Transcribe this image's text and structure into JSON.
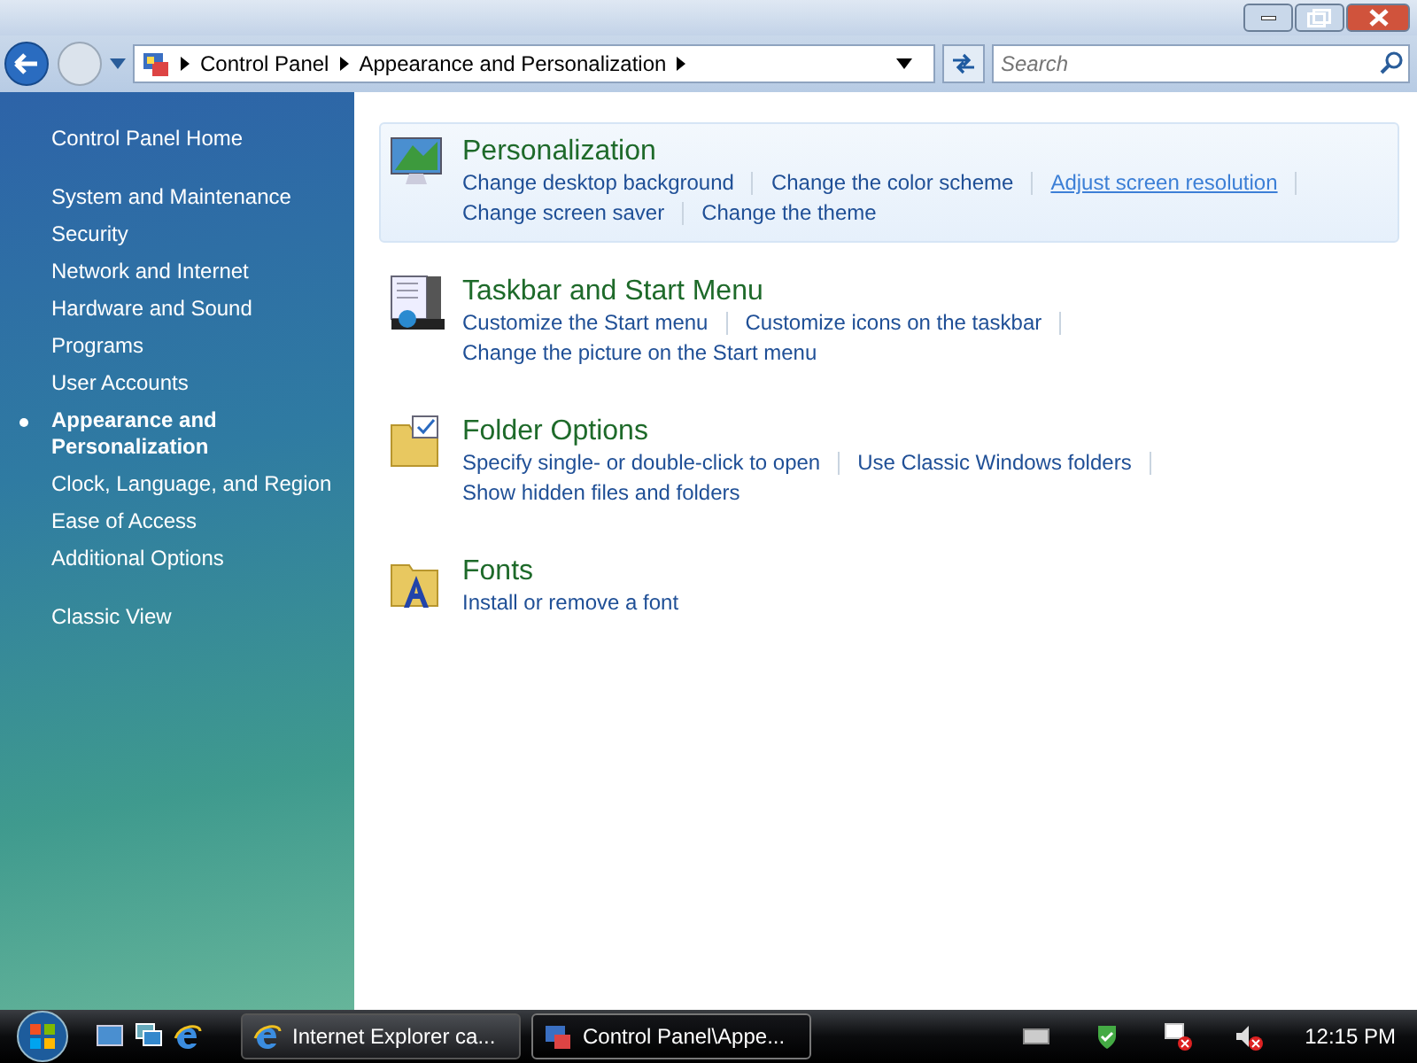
{
  "window": {
    "buttons": [
      {
        "kind": "minimize"
      },
      {
        "kind": "maximize"
      },
      {
        "kind": "close"
      }
    ]
  },
  "address_bar": {
    "breadcrumb": [
      "Control Panel",
      "Appearance and Personalization"
    ]
  },
  "search": {
    "placeholder": "Search"
  },
  "sidebar": {
    "home": "Control Panel Home",
    "items": [
      {
        "label": "System and Maintenance",
        "selected": false
      },
      {
        "label": "Security",
        "selected": false
      },
      {
        "label": "Network and Internet",
        "selected": false
      },
      {
        "label": "Hardware and Sound",
        "selected": false
      },
      {
        "label": "Programs",
        "selected": false
      },
      {
        "label": "User Accounts",
        "selected": false
      },
      {
        "label": "Appearance and Personalization",
        "selected": true
      },
      {
        "label": "Clock, Language, and Region",
        "selected": false
      },
      {
        "label": "Ease of Access",
        "selected": false
      },
      {
        "label": "Additional Options",
        "selected": false
      }
    ],
    "classic_view": "Classic View"
  },
  "categories": [
    {
      "kind": "monitor",
      "title": "Personalization",
      "hovered": true,
      "link_rows": [
        [
          {
            "text": "Change desktop background",
            "hovered": false
          },
          {
            "text": "Change the color scheme",
            "hovered": false
          },
          {
            "text": "Adjust screen resolution",
            "hovered": true
          }
        ],
        [
          {
            "text": "Change screen saver",
            "hovered": false
          },
          {
            "text": "Change the theme",
            "hovered": false
          }
        ]
      ]
    },
    {
      "kind": "taskbar",
      "title": "Taskbar and Start Menu",
      "hovered": false,
      "link_rows": [
        [
          {
            "text": "Customize the Start menu",
            "hovered": false
          },
          {
            "text": "Customize icons on the taskbar",
            "hovered": false
          }
        ],
        [
          {
            "text": "Change the picture on the Start menu",
            "hovered": false
          }
        ]
      ]
    },
    {
      "kind": "folder",
      "title": "Folder Options",
      "hovered": false,
      "link_rows": [
        [
          {
            "text": "Specify single- or double-click to open",
            "hovered": false
          },
          {
            "text": "Use Classic Windows folders",
            "hovered": false
          }
        ],
        [
          {
            "text": "Show hidden files and folders",
            "hovered": false
          }
        ]
      ]
    },
    {
      "kind": "fonts",
      "title": "Fonts",
      "hovered": false,
      "link_rows": [
        [
          {
            "text": "Install or remove a font",
            "hovered": false
          }
        ]
      ]
    }
  ],
  "taskbar": {
    "quick_launch": [
      {
        "kind": "desktop"
      },
      {
        "kind": "switch"
      },
      {
        "kind": "browser"
      }
    ],
    "tasks": [
      {
        "kind": "browser",
        "label": "Internet Explorer ca...",
        "selected": false
      },
      {
        "kind": "control-panel",
        "label": "Control Panel\\Appe...",
        "selected": true
      }
    ],
    "tray": [
      {
        "kind": "keyboard"
      },
      {
        "kind": "security"
      },
      {
        "kind": "network"
      },
      {
        "kind": "volume"
      }
    ],
    "clock": "12:15 PM"
  }
}
